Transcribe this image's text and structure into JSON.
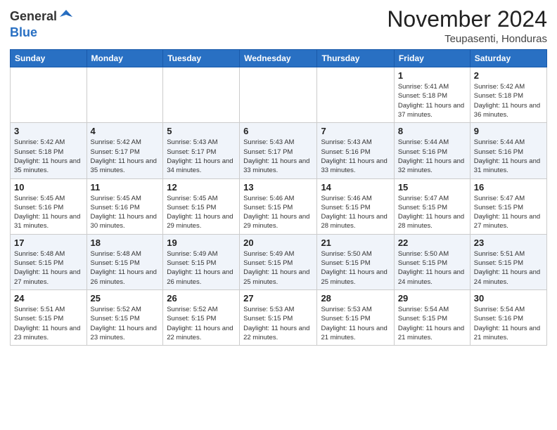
{
  "header": {
    "logo_general": "General",
    "logo_blue": "Blue",
    "month_title": "November 2024",
    "location": "Teupasenti, Honduras"
  },
  "weekdays": [
    "Sunday",
    "Monday",
    "Tuesday",
    "Wednesday",
    "Thursday",
    "Friday",
    "Saturday"
  ],
  "weeks": [
    [
      {
        "day": "",
        "info": ""
      },
      {
        "day": "",
        "info": ""
      },
      {
        "day": "",
        "info": ""
      },
      {
        "day": "",
        "info": ""
      },
      {
        "day": "",
        "info": ""
      },
      {
        "day": "1",
        "info": "Sunrise: 5:41 AM\nSunset: 5:18 PM\nDaylight: 11 hours\nand 37 minutes."
      },
      {
        "day": "2",
        "info": "Sunrise: 5:42 AM\nSunset: 5:18 PM\nDaylight: 11 hours\nand 36 minutes."
      }
    ],
    [
      {
        "day": "3",
        "info": "Sunrise: 5:42 AM\nSunset: 5:18 PM\nDaylight: 11 hours\nand 35 minutes."
      },
      {
        "day": "4",
        "info": "Sunrise: 5:42 AM\nSunset: 5:17 PM\nDaylight: 11 hours\nand 35 minutes."
      },
      {
        "day": "5",
        "info": "Sunrise: 5:43 AM\nSunset: 5:17 PM\nDaylight: 11 hours\nand 34 minutes."
      },
      {
        "day": "6",
        "info": "Sunrise: 5:43 AM\nSunset: 5:17 PM\nDaylight: 11 hours\nand 33 minutes."
      },
      {
        "day": "7",
        "info": "Sunrise: 5:43 AM\nSunset: 5:16 PM\nDaylight: 11 hours\nand 33 minutes."
      },
      {
        "day": "8",
        "info": "Sunrise: 5:44 AM\nSunset: 5:16 PM\nDaylight: 11 hours\nand 32 minutes."
      },
      {
        "day": "9",
        "info": "Sunrise: 5:44 AM\nSunset: 5:16 PM\nDaylight: 11 hours\nand 31 minutes."
      }
    ],
    [
      {
        "day": "10",
        "info": "Sunrise: 5:45 AM\nSunset: 5:16 PM\nDaylight: 11 hours\nand 31 minutes."
      },
      {
        "day": "11",
        "info": "Sunrise: 5:45 AM\nSunset: 5:16 PM\nDaylight: 11 hours\nand 30 minutes."
      },
      {
        "day": "12",
        "info": "Sunrise: 5:45 AM\nSunset: 5:15 PM\nDaylight: 11 hours\nand 29 minutes."
      },
      {
        "day": "13",
        "info": "Sunrise: 5:46 AM\nSunset: 5:15 PM\nDaylight: 11 hours\nand 29 minutes."
      },
      {
        "day": "14",
        "info": "Sunrise: 5:46 AM\nSunset: 5:15 PM\nDaylight: 11 hours\nand 28 minutes."
      },
      {
        "day": "15",
        "info": "Sunrise: 5:47 AM\nSunset: 5:15 PM\nDaylight: 11 hours\nand 28 minutes."
      },
      {
        "day": "16",
        "info": "Sunrise: 5:47 AM\nSunset: 5:15 PM\nDaylight: 11 hours\nand 27 minutes."
      }
    ],
    [
      {
        "day": "17",
        "info": "Sunrise: 5:48 AM\nSunset: 5:15 PM\nDaylight: 11 hours\nand 27 minutes."
      },
      {
        "day": "18",
        "info": "Sunrise: 5:48 AM\nSunset: 5:15 PM\nDaylight: 11 hours\nand 26 minutes."
      },
      {
        "day": "19",
        "info": "Sunrise: 5:49 AM\nSunset: 5:15 PM\nDaylight: 11 hours\nand 26 minutes."
      },
      {
        "day": "20",
        "info": "Sunrise: 5:49 AM\nSunset: 5:15 PM\nDaylight: 11 hours\nand 25 minutes."
      },
      {
        "day": "21",
        "info": "Sunrise: 5:50 AM\nSunset: 5:15 PM\nDaylight: 11 hours\nand 25 minutes."
      },
      {
        "day": "22",
        "info": "Sunrise: 5:50 AM\nSunset: 5:15 PM\nDaylight: 11 hours\nand 24 minutes."
      },
      {
        "day": "23",
        "info": "Sunrise: 5:51 AM\nSunset: 5:15 PM\nDaylight: 11 hours\nand 24 minutes."
      }
    ],
    [
      {
        "day": "24",
        "info": "Sunrise: 5:51 AM\nSunset: 5:15 PM\nDaylight: 11 hours\nand 23 minutes."
      },
      {
        "day": "25",
        "info": "Sunrise: 5:52 AM\nSunset: 5:15 PM\nDaylight: 11 hours\nand 23 minutes."
      },
      {
        "day": "26",
        "info": "Sunrise: 5:52 AM\nSunset: 5:15 PM\nDaylight: 11 hours\nand 22 minutes."
      },
      {
        "day": "27",
        "info": "Sunrise: 5:53 AM\nSunset: 5:15 PM\nDaylight: 11 hours\nand 22 minutes."
      },
      {
        "day": "28",
        "info": "Sunrise: 5:53 AM\nSunset: 5:15 PM\nDaylight: 11 hours\nand 21 minutes."
      },
      {
        "day": "29",
        "info": "Sunrise: 5:54 AM\nSunset: 5:15 PM\nDaylight: 11 hours\nand 21 minutes."
      },
      {
        "day": "30",
        "info": "Sunrise: 5:54 AM\nSunset: 5:16 PM\nDaylight: 11 hours\nand 21 minutes."
      }
    ]
  ]
}
